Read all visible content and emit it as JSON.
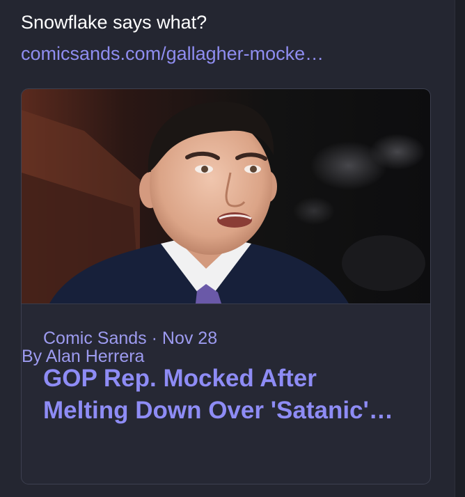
{
  "post": {
    "text": "Snowflake says what?",
    "link_text": "comicsands.com/gallagher-mocke…"
  },
  "card": {
    "image_icon": "news-photo",
    "source": "Comic Sands",
    "separator": "·",
    "date": "Nov 28",
    "headline_line1": "GOP Rep. Mocked After",
    "headline_line2": "Melting Down Over 'Satanic'…",
    "byline": "By Alan Herrera"
  },
  "colors": {
    "background": "#242631",
    "text": "#ffffff",
    "link": "#8f8df0",
    "card_border": "#3d4050"
  }
}
